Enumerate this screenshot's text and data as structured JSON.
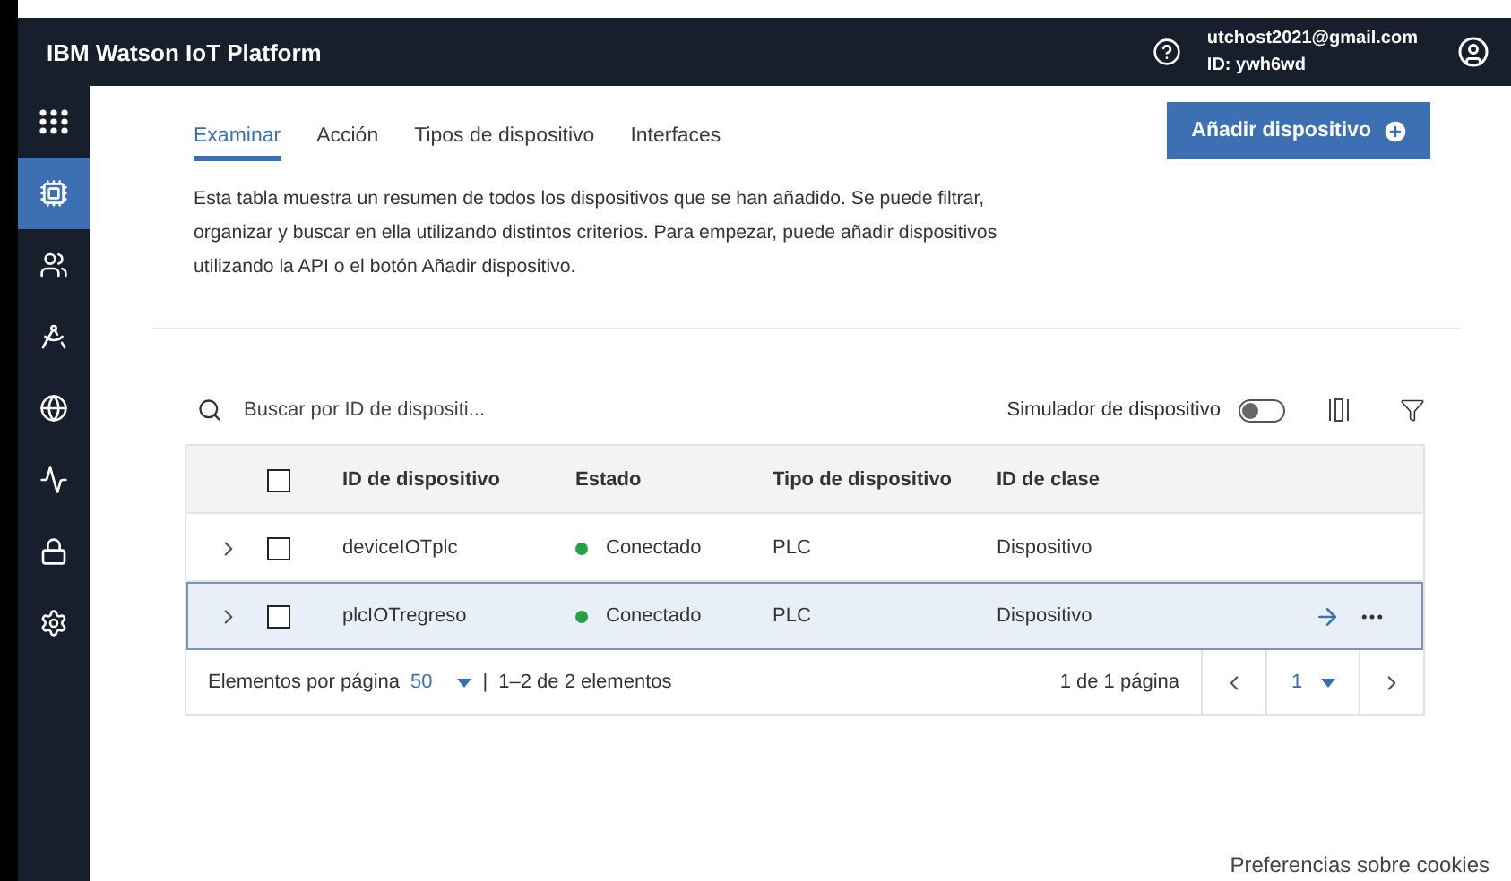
{
  "header": {
    "title": "IBM Watson IoT Platform",
    "user_email": "utchost2021@gmail.com",
    "user_id": "ID: ywh6wd"
  },
  "sidebar": [
    {
      "kind": "grid",
      "selected": false
    },
    {
      "kind": "chip",
      "selected": true
    },
    {
      "kind": "people",
      "selected": false
    },
    {
      "kind": "compass",
      "selected": false
    },
    {
      "kind": "globe",
      "selected": false
    },
    {
      "kind": "chart",
      "selected": false
    },
    {
      "kind": "lock",
      "selected": false
    },
    {
      "kind": "gear",
      "selected": false
    }
  ],
  "tabs": [
    {
      "label": "Examinar",
      "selected": true
    },
    {
      "label": "Acción",
      "selected": false
    },
    {
      "label": "Tipos de dispositivo",
      "selected": false
    },
    {
      "label": "Interfaces",
      "selected": false
    }
  ],
  "add_button": "Añadir dispositivo",
  "description": "Esta tabla muestra un resumen de todos los dispositivos que se han añadido. Se puede filtrar, organizar y buscar en ella utilizando distintos criterios. Para empezar, puede añadir dispositivos utilizando la API o el botón Añadir dispositivo.",
  "search": {
    "placeholder": "Buscar por ID de dispositi..."
  },
  "simulator": {
    "label": "Simulador de dispositivo",
    "on": false
  },
  "table": {
    "select_all_checked": false,
    "columns": [
      "ID de dispositivo",
      "Estado",
      "Tipo de dispositivo",
      "ID de clase"
    ],
    "rows": [
      {
        "id": "deviceIOTplc",
        "status": "Conectado",
        "color": "#24a148",
        "type": "PLC",
        "class": "Dispositivo",
        "checked": false,
        "selected": false
      },
      {
        "id": "plcIOTregreso",
        "status": "Conectado",
        "color": "#24a148",
        "type": "PLC",
        "class": "Dispositivo",
        "checked": false,
        "selected": true
      }
    ]
  },
  "pagination": {
    "per_page_label": "Elementos por página",
    "per_page_value": "50",
    "separator": "|",
    "range": "1–2 de 2 elementos",
    "page_info": "1 de 1 página",
    "page": "1"
  },
  "footer_link": "Preferencias sobre cookies"
}
